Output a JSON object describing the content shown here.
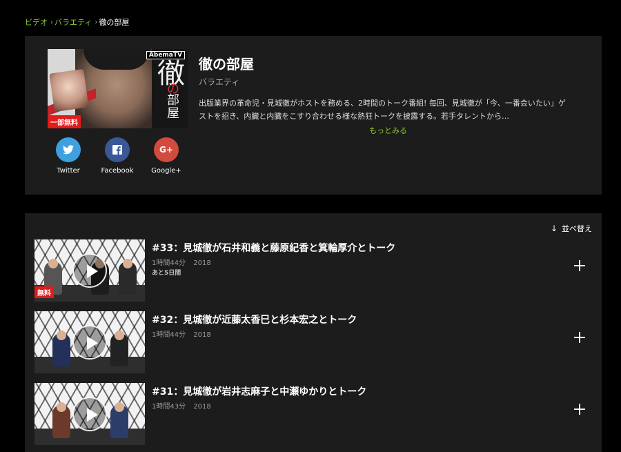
{
  "breadcrumb": {
    "items": [
      "ビデオ",
      "バラエティ"
    ],
    "current": "徹の部屋",
    "separator": "›"
  },
  "show": {
    "title": "徹の部屋",
    "genre": "バラエティ",
    "description": "出版業界の革命児・見城徹がホストを務める、2時間のトーク番組! 毎回、見城徹が「今、一番会いたい」ゲストを招き、内臓と内臓をこすり合わせる様な熱狂トークを披露する。若手タレントから…",
    "more_label": "もっとみる",
    "thumbnail": {
      "logo_text": "AbemaTV",
      "kanji_big": "徹",
      "kanji_no": "の",
      "kanji_small": "部屋",
      "badge": "一部無料"
    }
  },
  "social": {
    "twitter": {
      "label": "Twitter",
      "icon": "twitter-bird-icon",
      "color": "#3fa0e0"
    },
    "facebook": {
      "label": "Facebook",
      "icon": "facebook-f-icon",
      "color": "#3a5896"
    },
    "google": {
      "label": "Google+",
      "icon": "google-plus-icon",
      "color": "#d14b3e",
      "glyph": "G+"
    }
  },
  "episodes_header": {
    "sort_label": "並べ替え",
    "sort_icon": "arrow-down-icon"
  },
  "episodes": [
    {
      "title": "#33：見城徹が石井和義と藤原紀香と箕輪厚介とトーク",
      "duration": "1時間44分",
      "year": "2018",
      "remaining": "あと5日間",
      "badge": "無料"
    },
    {
      "title": "#32：見城徹が近藤太香巳と杉本宏之とトーク",
      "duration": "1時間44分",
      "year": "2018",
      "remaining": "",
      "badge": ""
    },
    {
      "title": "#31：見城徹が岩井志麻子と中瀬ゆかりとトーク",
      "duration": "1時間43分",
      "year": "2018",
      "remaining": "",
      "badge": ""
    }
  ],
  "colors": {
    "accent_green": "#8ccf2e",
    "panel_bg": "#1c1c1c",
    "free_red": "#e21b1b"
  }
}
